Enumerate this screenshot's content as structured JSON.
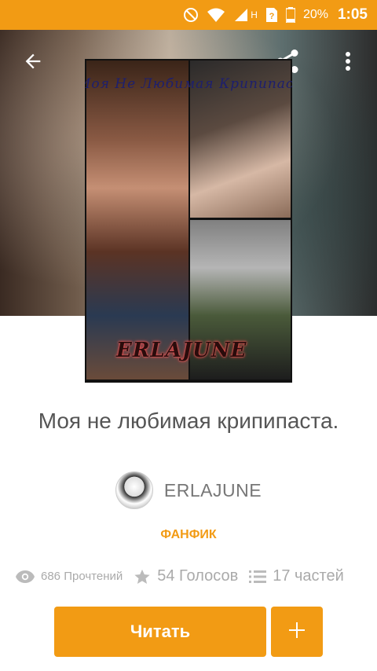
{
  "status_bar": {
    "network": "H",
    "battery": "20%",
    "time": "1:05"
  },
  "toolbar": {
    "back_icon": "arrow-left-icon",
    "share_icon": "share-icon",
    "menu_icon": "more-vert-icon"
  },
  "cover": {
    "title_text": "Моя Не Любимая Крипипаста",
    "author_text": "ERLAJUNE"
  },
  "story": {
    "title": "Моя не любимая крипипаста.",
    "author": "ERLAJUNE",
    "category": "ФАНФИК"
  },
  "stats": {
    "reads": "686 Прочтений",
    "votes": "54 Голосов",
    "parts": "17 частей"
  },
  "actions": {
    "read_label": "Читать",
    "add_label": "+"
  },
  "colors": {
    "accent": "#f29b14",
    "text_main": "#555555",
    "text_muted": "#aaaaaa"
  }
}
